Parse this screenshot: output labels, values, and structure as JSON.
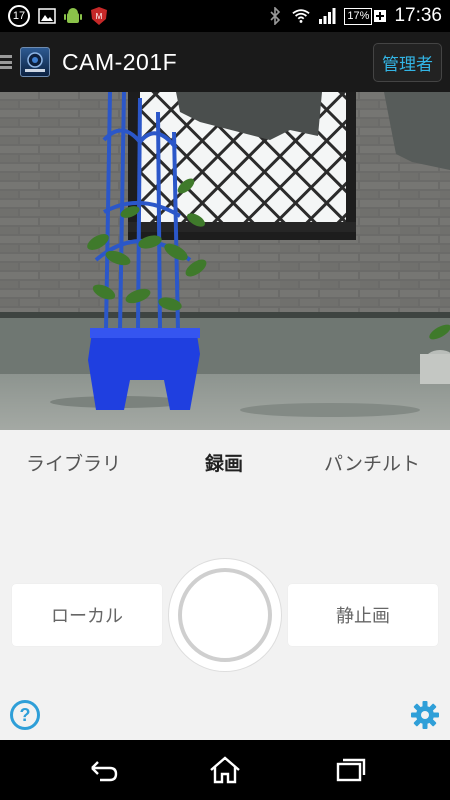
{
  "status_bar": {
    "notification_count": "17",
    "battery_percent": "17%",
    "time": "17:36"
  },
  "app_bar": {
    "title": "CAM-201F",
    "admin_label": "管理者"
  },
  "tabs": [
    {
      "label": "ライブラリ",
      "active": false
    },
    {
      "label": "録画",
      "active": true
    },
    {
      "label": "パンチルト",
      "active": false
    }
  ],
  "controls": {
    "local_label": "ローカル",
    "still_label": "静止画",
    "help_symbol": "?"
  },
  "colors": {
    "accent": "#33b5e5",
    "help_blue": "#2f9fd8",
    "panel_bg": "#f2f2f2"
  }
}
